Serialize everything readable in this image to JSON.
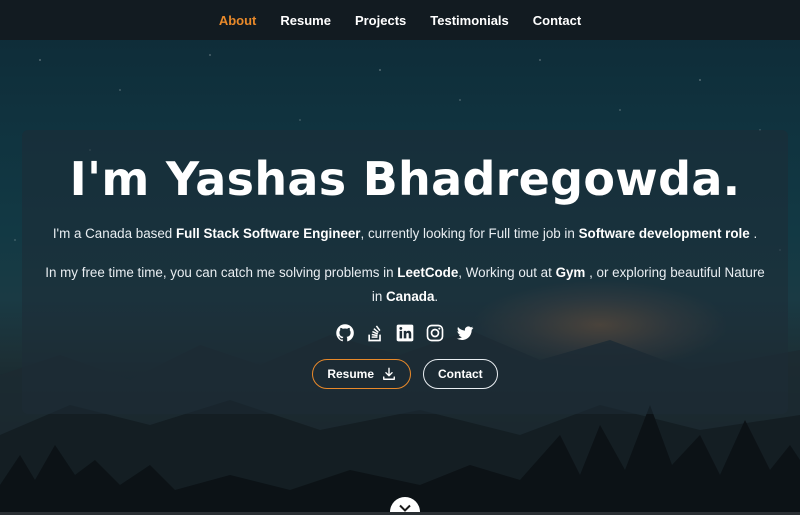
{
  "nav": {
    "items": [
      {
        "label": "About",
        "active": true
      },
      {
        "label": "Resume",
        "active": false
      },
      {
        "label": "Projects",
        "active": false
      },
      {
        "label": "Testimonials",
        "active": false
      },
      {
        "label": "Contact",
        "active": false
      }
    ]
  },
  "hero": {
    "title": "I'm Yashas Bhadregowda.",
    "intro": {
      "part1": "I'm a Canada based ",
      "role": "Full Stack Software Engineer",
      "part2": ", currently looking for Full time job in ",
      "target": "Software development role",
      "part3": " ."
    },
    "hobbies": {
      "part1": "In my free time time, you can catch me solving problems in ",
      "site": "LeetCode",
      "part2": ", Working out at ",
      "gym": "Gym",
      "part3": " , or exploring beautiful Nature in ",
      "place": "Canada",
      "part4": "."
    },
    "social_icons": [
      "github-icon",
      "stackoverflow-icon",
      "linkedin-icon",
      "instagram-icon",
      "twitter-icon"
    ],
    "buttons": {
      "resume_label": "Resume",
      "contact_label": "Contact"
    }
  },
  "colors": {
    "accent": "#e8892a",
    "nav_bg": "#121a20",
    "text": "#ffffff"
  }
}
